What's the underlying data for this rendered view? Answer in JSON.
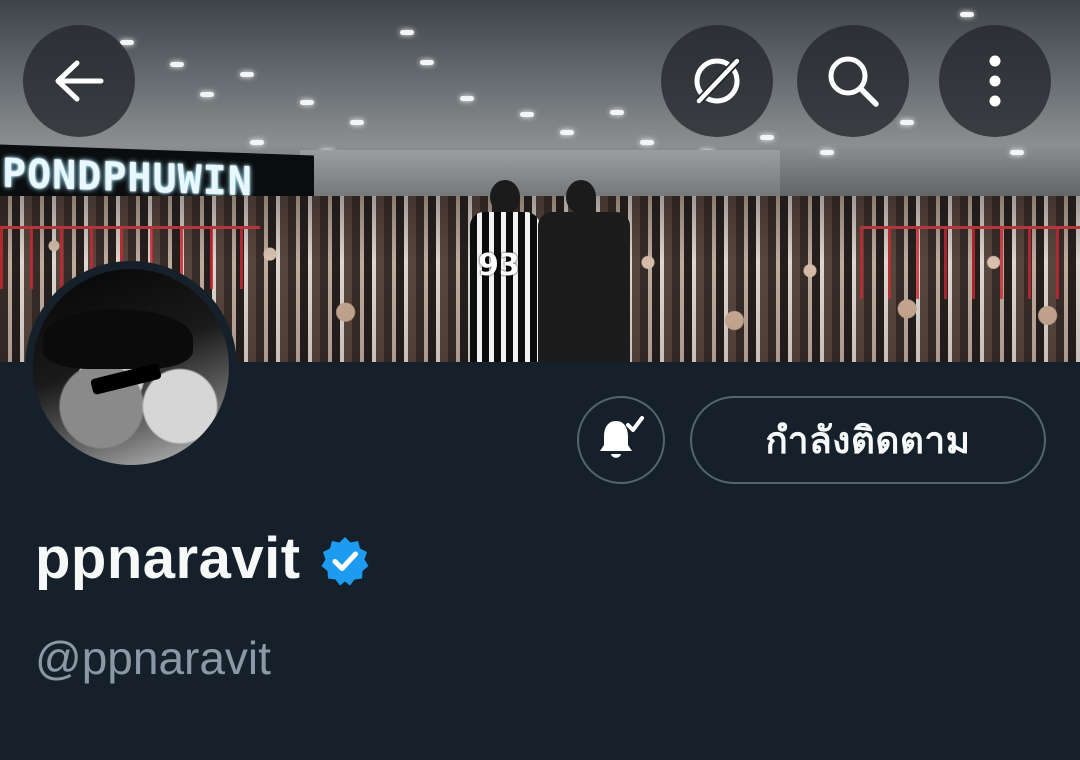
{
  "banner": {
    "led_sign_text": "PONDPHUWIN",
    "jersey_number": "93"
  },
  "header": {
    "back_icon": "arrow-left-icon",
    "grok_icon": "grok-icon",
    "search_icon": "search-icon",
    "more_icon": "more-vertical-icon"
  },
  "profile": {
    "display_name": "ppnaravit",
    "handle": "@ppnaravit",
    "verified": true,
    "follow_button_label": "กำลังติดตาม",
    "notification_icon": "bell-check-icon"
  },
  "colors": {
    "background": "#15202b",
    "text_primary": "#f7f9f9",
    "text_secondary": "#8b98a5",
    "border": "#536471",
    "verified_blue": "#1d9bf0"
  }
}
